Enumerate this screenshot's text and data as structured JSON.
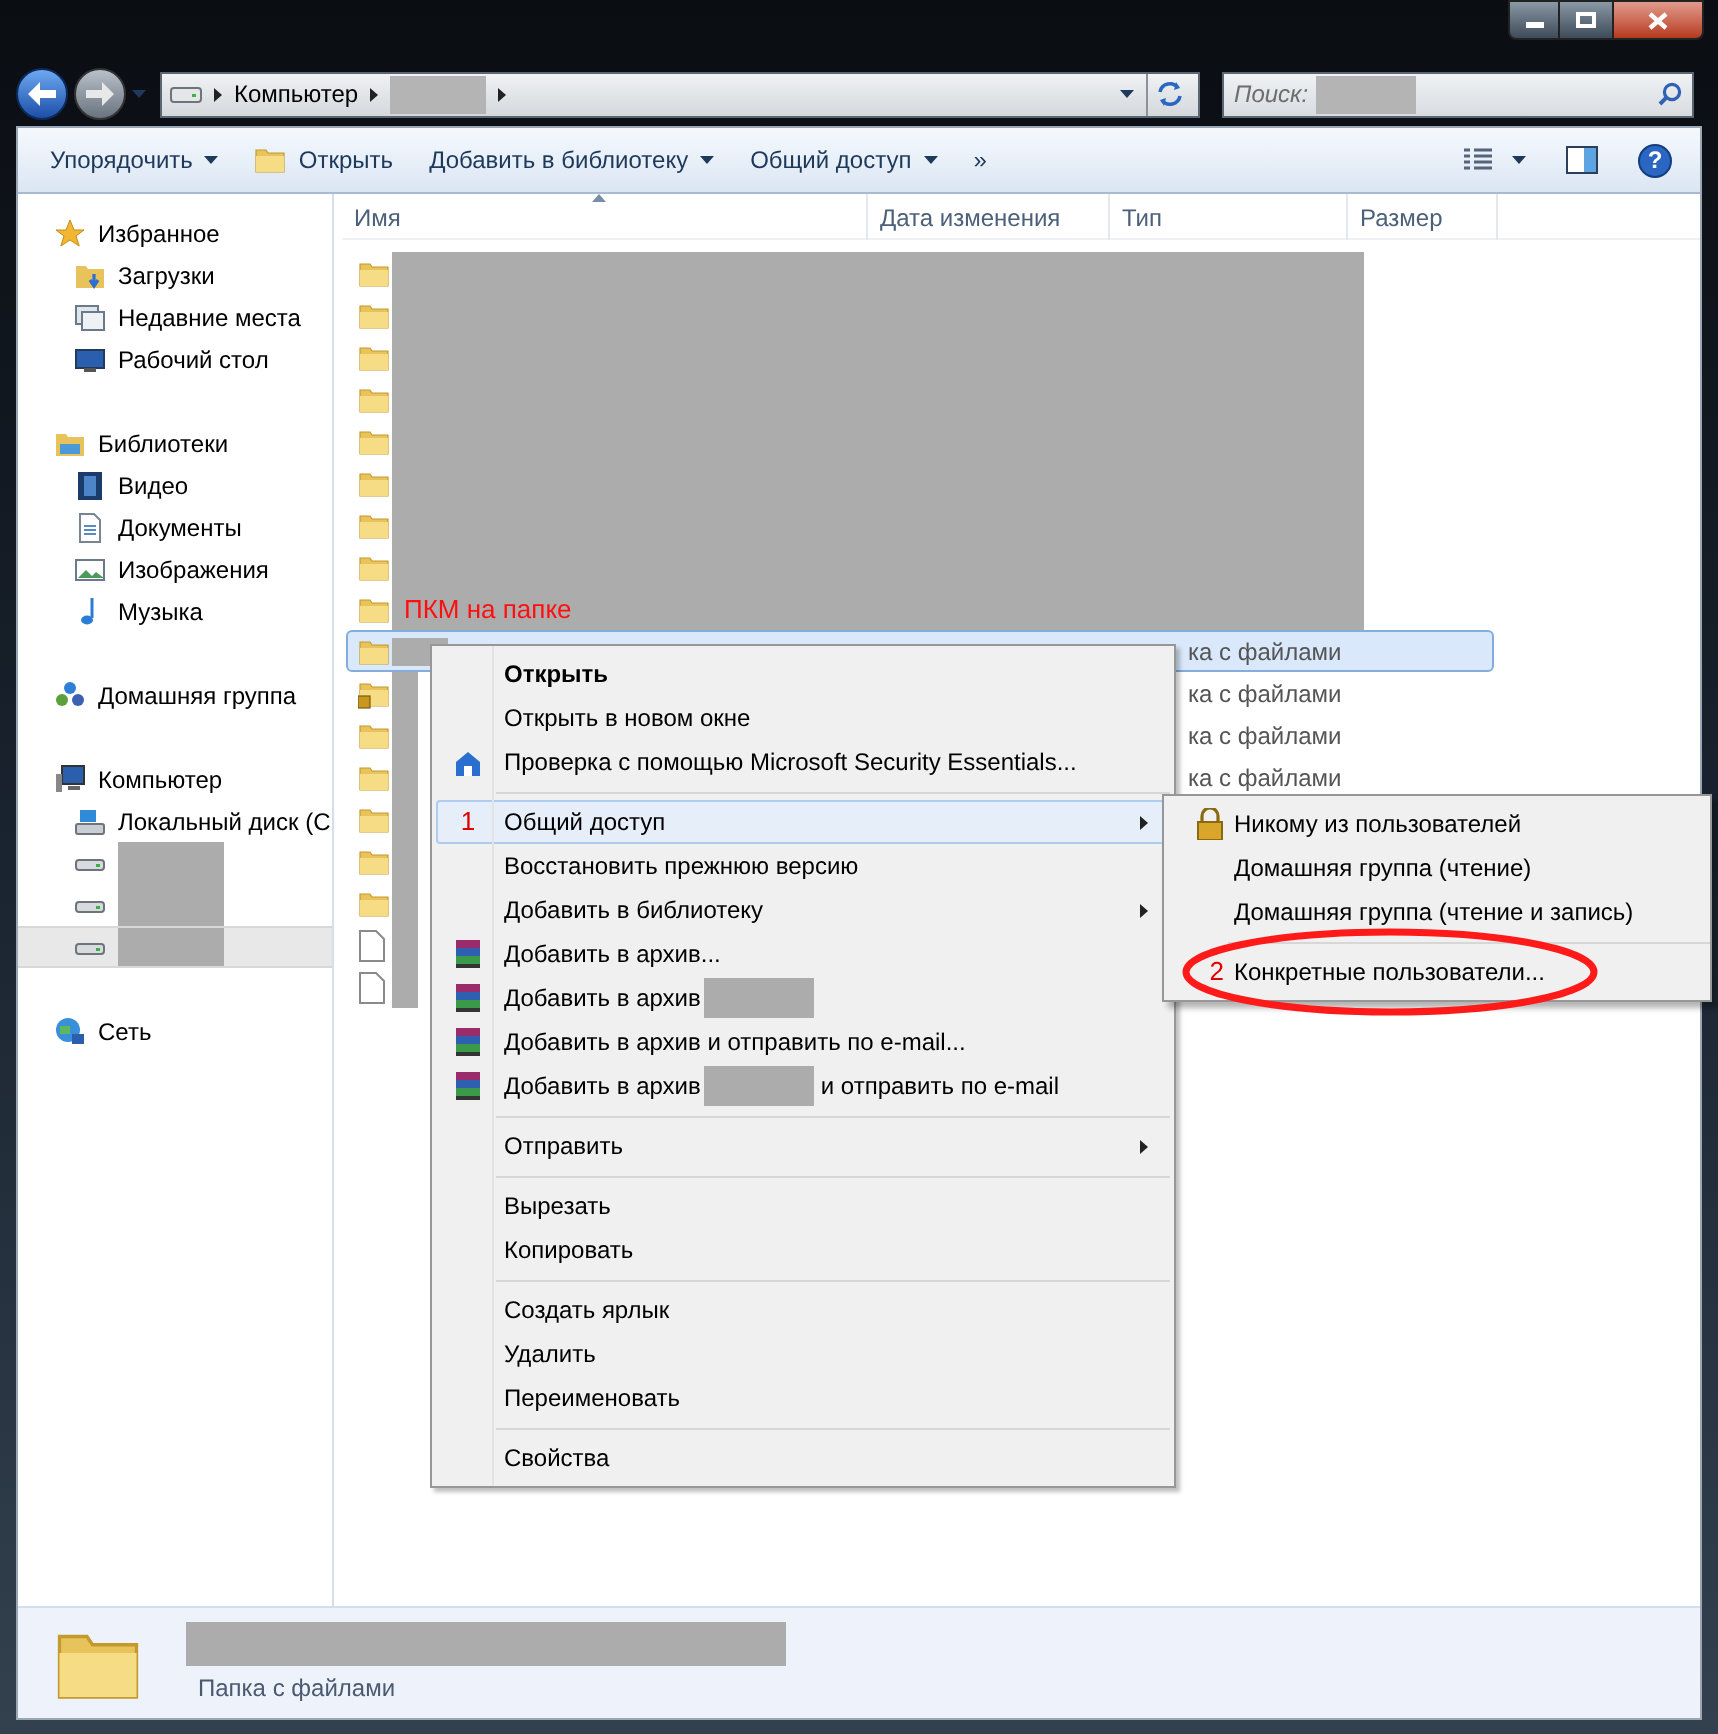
{
  "address_bar": {
    "location": "Компьютер",
    "sub_redacted": true
  },
  "search": {
    "placeholder": "Поиск:",
    "redacted": true
  },
  "toolbar": [
    {
      "kind": "dropdown",
      "label": "Упорядочить"
    },
    {
      "kind": "icon",
      "label": "Открыть"
    },
    {
      "kind": "dropdown",
      "label": "Добавить в библиотеку"
    },
    {
      "kind": "dropdown",
      "label": "Общий доступ"
    },
    {
      "kind": "overflow",
      "label": "»"
    }
  ],
  "help_button": "?",
  "nav": [
    {
      "kind": "favorites",
      "label": "Избранное",
      "selected": false,
      "children": [
        {
          "kind": "downloads",
          "label": "Загрузки",
          "selected": false
        },
        {
          "kind": "recent",
          "label": "Недавние места",
          "selected": false
        },
        {
          "kind": "desktop",
          "label": "Рабочий стол",
          "selected": false
        }
      ]
    },
    {
      "kind": "libraries",
      "label": "Библиотеки",
      "selected": false,
      "children": [
        {
          "kind": "video",
          "label": "Видео",
          "selected": false
        },
        {
          "kind": "documents",
          "label": "Документы",
          "selected": false
        },
        {
          "kind": "images",
          "label": "Изображения",
          "selected": false
        },
        {
          "kind": "music",
          "label": "Музыка",
          "selected": false
        }
      ]
    },
    {
      "kind": "homegroup",
      "label": "Домашняя группа",
      "selected": false
    },
    {
      "kind": "computer",
      "label": "Компьютер",
      "selected": false,
      "children": [
        {
          "kind": "system-drive",
          "label": "Локальный диск (С",
          "selected": false
        },
        {
          "kind": "drive",
          "redacted": true,
          "selected": false
        },
        {
          "kind": "drive",
          "redacted": true,
          "selected": false
        },
        {
          "kind": "drive",
          "redacted": true,
          "selected": true
        }
      ]
    },
    {
      "kind": "network",
      "label": "Сеть",
      "selected": false
    }
  ],
  "columns": [
    {
      "label": "Имя",
      "sorted": true
    },
    {
      "label": "Дата изменения"
    },
    {
      "label": "Тип"
    },
    {
      "label": "Размер"
    }
  ],
  "rows": [
    {
      "kind": "masked-folder",
      "selected": false,
      "redacted": true
    },
    {
      "kind": "masked-folder",
      "selected": false,
      "redacted": true
    },
    {
      "kind": "masked-folder",
      "selected": false,
      "redacted": true
    },
    {
      "kind": "masked-folder",
      "selected": false,
      "redacted": true
    },
    {
      "kind": "masked-folder",
      "selected": false,
      "redacted": true
    },
    {
      "kind": "masked-folder",
      "selected": false,
      "redacted": true
    },
    {
      "kind": "masked-folder",
      "selected": false,
      "redacted": true
    },
    {
      "kind": "masked-folder",
      "selected": false,
      "redacted": true
    },
    {
      "kind": "folder",
      "selected": false,
      "annotation": "ПКМ на папке"
    },
    {
      "kind": "folder",
      "selected": true,
      "redacted": true,
      "type": "ка с файлами"
    },
    {
      "kind": "locked-folder",
      "selected": false,
      "redacted": true,
      "type": "ка с файлами"
    },
    {
      "kind": "folder",
      "selected": false,
      "redacted": true,
      "type": "ка с файлами"
    },
    {
      "kind": "folder",
      "selected": false,
      "redacted": true,
      "type": "ка с файлами"
    },
    {
      "kind": "folder",
      "selected": false,
      "redacted": true
    },
    {
      "kind": "folder",
      "selected": false,
      "redacted": true
    },
    {
      "kind": "folder",
      "selected": false,
      "redacted": true
    },
    {
      "kind": "file",
      "selected": false,
      "redacted": true
    },
    {
      "kind": "file",
      "selected": false,
      "redacted": true
    }
  ],
  "context_menu": [
    {
      "kind": "item",
      "label": "Открыть",
      "bold": true,
      "highlighted": false,
      "submenu": false
    },
    {
      "kind": "item",
      "label": "Открыть в новом окне",
      "bold": false,
      "highlighted": false,
      "submenu": false
    },
    {
      "kind": "security",
      "label": "Проверка с помощью Microsoft Security Essentials...",
      "bold": false,
      "highlighted": false,
      "submenu": false
    },
    {
      "kind": "separator"
    },
    {
      "kind": "item",
      "label": "Общий доступ",
      "bold": false,
      "highlighted": true,
      "submenu": true,
      "step": "1"
    },
    {
      "kind": "item",
      "label": "Восстановить прежнюю версию",
      "bold": false,
      "highlighted": false,
      "submenu": false
    },
    {
      "kind": "item",
      "label": "Добавить в библиотеку",
      "bold": false,
      "highlighted": false,
      "submenu": true
    },
    {
      "kind": "archive",
      "label": "Добавить в архив...",
      "bold": false,
      "highlighted": false,
      "submenu": false
    },
    {
      "kind": "archive",
      "label": "Добавить в архив",
      "redacted": true,
      "bold": false,
      "highlighted": false,
      "submenu": false
    },
    {
      "kind": "archive",
      "label": "Добавить в архив и отправить по e-mail...",
      "bold": false,
      "highlighted": false,
      "submenu": false
    },
    {
      "kind": "archive",
      "label": "Добавить в архив",
      "redacted": true,
      "label_after": "и отправить по e-mail",
      "bold": false,
      "highlighted": false,
      "submenu": false
    },
    {
      "kind": "separator"
    },
    {
      "kind": "item",
      "label": "Отправить",
      "bold": false,
      "highlighted": false,
      "submenu": true
    },
    {
      "kind": "separator"
    },
    {
      "kind": "item",
      "label": "Вырезать",
      "bold": false,
      "highlighted": false,
      "submenu": false
    },
    {
      "kind": "item",
      "label": "Копировать",
      "bold": false,
      "highlighted": false,
      "submenu": false
    },
    {
      "kind": "separator"
    },
    {
      "kind": "item",
      "label": "Создать ярлык",
      "bold": false,
      "highlighted": false,
      "submenu": false
    },
    {
      "kind": "item",
      "label": "Удалить",
      "bold": false,
      "highlighted": false,
      "submenu": false
    },
    {
      "kind": "item",
      "label": "Переименовать",
      "bold": false,
      "highlighted": false,
      "submenu": false
    },
    {
      "kind": "separator"
    },
    {
      "kind": "item",
      "label": "Свойства",
      "bold": false,
      "highlighted": false,
      "submenu": false
    }
  ],
  "submenu": [
    {
      "kind": "lock",
      "label": "Никому из пользователей"
    },
    {
      "kind": "item",
      "label": "Домашняя группа (чтение)"
    },
    {
      "kind": "item",
      "label": "Домашняя группа (чтение и запись)"
    },
    {
      "kind": "separator"
    },
    {
      "kind": "item",
      "label": "Конкретные пользователи...",
      "step": "2",
      "circled": true
    }
  ],
  "details": {
    "name_redacted": true,
    "type": "Папка с файлами"
  }
}
